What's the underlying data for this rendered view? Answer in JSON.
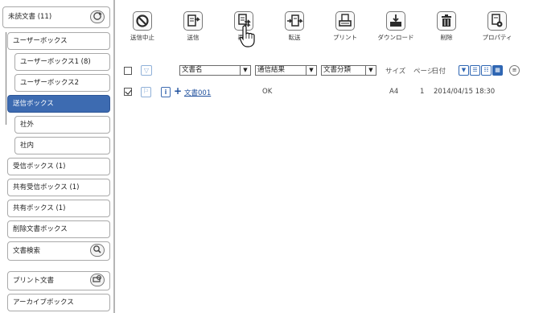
{
  "sidebar": {
    "unread": {
      "label": "未読文書 (11)"
    },
    "user_box": {
      "label": "ユーザーボックス"
    },
    "user_box_1": {
      "label": "ユーザーボックス1 (8)"
    },
    "user_box_2": {
      "label": "ユーザーボックス2"
    },
    "send_box": {
      "label": "送信ボックス"
    },
    "external": {
      "label": "社外"
    },
    "internal": {
      "label": "社内"
    },
    "receive_box": {
      "label": "受信ボックス (1)"
    },
    "shared_receive_box": {
      "label": "共有受信ボックス (1)"
    },
    "shared_box": {
      "label": "共有ボックス (1)"
    },
    "deleted_box": {
      "label": "削除文書ボックス"
    },
    "doc_search": {
      "label": "文書検索"
    },
    "print_doc": {
      "label": "プリント文書"
    },
    "archive_box": {
      "label": "アーカイブボックス"
    }
  },
  "toolbar": {
    "cancel_send": "送信中止",
    "send": "送信",
    "resend": "再送",
    "forward": "転送",
    "print": "プリント",
    "download": "ダウンロード",
    "delete": "削除",
    "properties": "プロパティ"
  },
  "header": {
    "doc_name": "文書名",
    "send_result": "通信結果",
    "doc_class": "文書分類",
    "size": "サイズ",
    "page": "ページ",
    "date": "日付"
  },
  "rows": [
    {
      "name": "文書001",
      "result": "OK",
      "size": "A4",
      "pages": "1",
      "date": "2014/04/15 18:30",
      "checked": true
    }
  ],
  "colors": {
    "accent": "#3d6bb1",
    "link": "#1e4f9c"
  }
}
